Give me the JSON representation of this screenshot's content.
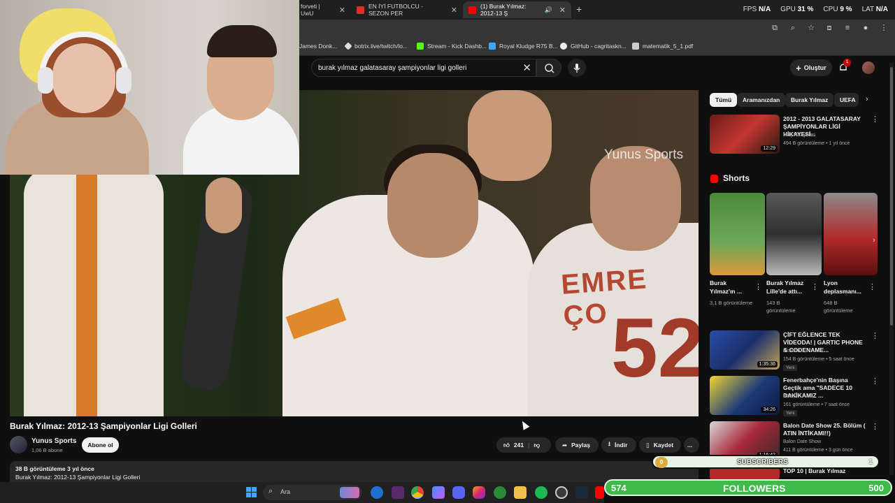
{
  "browser": {
    "tabs": [
      {
        "label": "forveti | UwU",
        "color": "#2c6fd8"
      },
      {
        "label": "EN İYİ FUTBOLCU - SEZON PER",
        "color": "#e52d27"
      },
      {
        "label": "(1) Burak Yılmaz: 2012-13 Ş",
        "color": "#ff0000"
      }
    ],
    "new_tab": "+",
    "stats": [
      {
        "label": "FPS",
        "value": "N/A"
      },
      {
        "label": "GPU",
        "value": "31 %"
      },
      {
        "label": "CPU",
        "value": "9 %"
      },
      {
        "label": "LAT",
        "value": "N/A"
      }
    ],
    "bookmarks": [
      {
        "label": "James Donk...",
        "color": "#999"
      },
      {
        "label": "botrix.live/twitch/lo...",
        "color": "#ddd"
      },
      {
        "label": "Stream - Kick Dashb...",
        "color": "#53fc18"
      },
      {
        "label": "Royal Kludge R75 B...",
        "color": "#3da8ff"
      },
      {
        "label": "GitHub - cagritaskn...",
        "color": "#eee"
      },
      {
        "label": "matematik_5_1.pdf",
        "color": "#ccc"
      }
    ]
  },
  "youtube": {
    "search_query": "burak yılmaz galatasaray şampiyonlar ligi golleri",
    "create_label": "Oluştur",
    "notif_count": "1",
    "video": {
      "watermark": "Yunus Sports",
      "title": "Burak Yılmaz: 2012-13 Şampiyonlar Ligi Golleri",
      "channel": "Yunus Sports",
      "subs": "1,06 B abone",
      "subscribe_label": "Abone ol",
      "likes": "241",
      "share_label": "Paylaş",
      "download_label": "İndir",
      "save_label": "Kaydet",
      "more_label": "...",
      "meta": "38 B görüntüleme  3 yıl önce",
      "desc_line": "Burak Yılmaz: 2012-13 Şampiyonlar Ligi Golleri",
      "jersey_text": "EMRE ÇO",
      "jersey_num": "52"
    },
    "chips": [
      "Tümü",
      "Aramanızdan",
      "Burak Yılmaz",
      "UEFA"
    ],
    "first_rec": {
      "title": "2012 - 2013 GALATASARAY ŞAMPİYONLAR LİGİ HİKAYESİ...",
      "channel": "Maç Hikayeleri",
      "meta": "494 B görüntüleme • 1 yıl önce",
      "duration": "12:29"
    },
    "shorts_title": "Shorts",
    "shorts": [
      {
        "title": "Burak Yılmaz'ın ...",
        "views": "3,1 B görüntüleme"
      },
      {
        "title": "Burak Yılmaz Lille'de attı...",
        "views": "143 B görüntüleme"
      },
      {
        "title": "Lyon deplasmanı...",
        "views": "648 B görüntüleme"
      }
    ],
    "recs": [
      {
        "title": "ÇİFT EĞLENCE TEK VİDEODA! | GARTIC PHONE & CODENAME...",
        "channel": "Elraenn",
        "meta": "154 B görüntüleme • 5 saat önce",
        "duration": "1:35:36",
        "badge": "Yeni"
      },
      {
        "title": "Fenerbahçe'nin Başına Geçtik ama \"SADECE 10 DAKİKAMIZ ...",
        "channel": "BRNK",
        "meta": "161 görüntüleme • 7 saat önce",
        "duration": "34:26",
        "badge": "Yeni"
      },
      {
        "title": "Balon Date Show 25. Bölüm ( ATIN İNTİKAMI!!)",
        "channel": "Balon Date Show",
        "meta": "411 B görüntüleme • 3 gün önce",
        "duration": "1:16:42",
        "badge": ""
      },
      {
        "title": "TOP 10 | Burak Yılmaz",
        "channel": "",
        "meta": "",
        "duration": "",
        "badge": ""
      }
    ]
  },
  "overlays": {
    "subscribers": {
      "label": "SUBSCRIBERS",
      "current": "0",
      "goal": "1"
    },
    "followers": {
      "label": "FOLLOWERS",
      "current": "574",
      "goal": "500"
    }
  },
  "taskbar": {
    "search_label": "Ara"
  }
}
